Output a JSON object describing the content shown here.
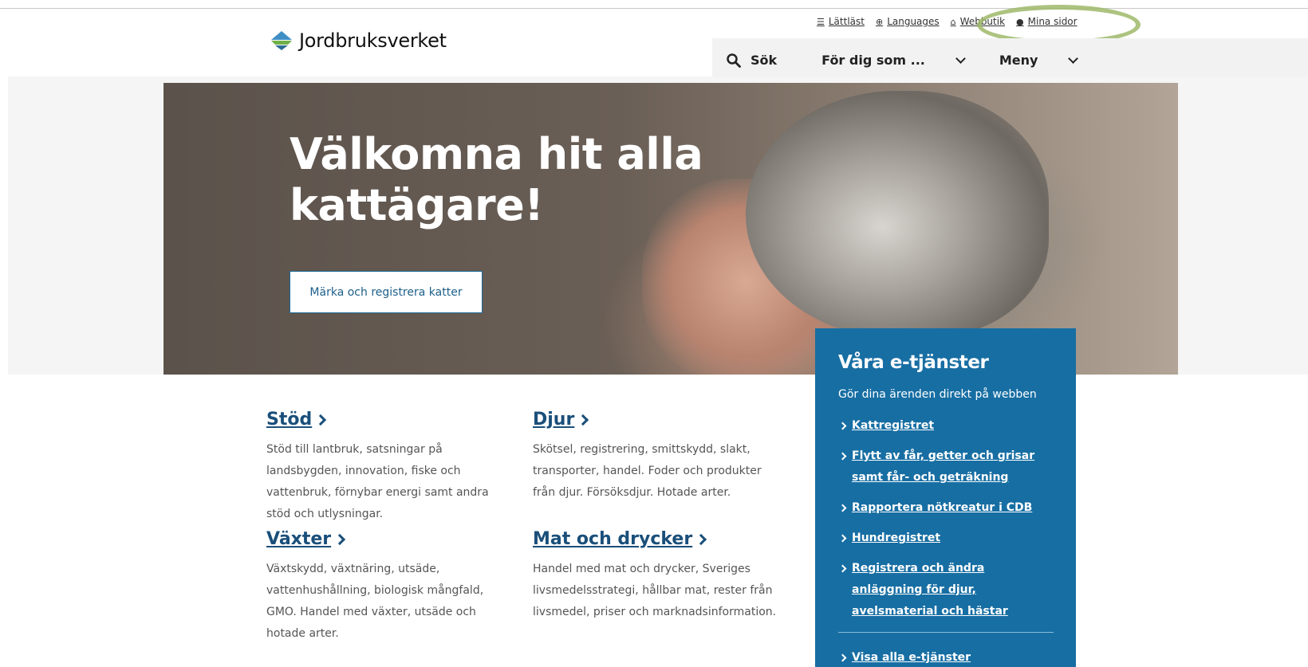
{
  "utility_bar": {
    "items": [
      {
        "label": "Lättläst",
        "icon": "easy-read-icon"
      },
      {
        "label": "Languages",
        "icon": "globe-icon"
      },
      {
        "label": "Webbutik",
        "icon": "basket-icon"
      },
      {
        "label": "Mina sidor",
        "icon": "user-icon"
      }
    ]
  },
  "logo": {
    "text": "Jordbruksverket"
  },
  "nav": {
    "search_label": "Sök",
    "for_you_label": "För dig som ...",
    "menu_label": "Meny"
  },
  "hero": {
    "title": "Välkomna hit alla kattägare!",
    "button_label": "Märka och registrera katter"
  },
  "categories": [
    {
      "title": "Stöd",
      "text": "Stöd till lantbruk, satsningar på landsbygden, innovation, fiske och vattenbruk, förnybar energi samt andra stöd och utlysningar."
    },
    {
      "title": "Djur",
      "text": "Skötsel, registrering, smittskydd, slakt, transporter, handel. Foder och produkter från djur. Försöksdjur. Hotade arter."
    },
    {
      "title": "Växter",
      "text": "Växtskydd, växtnäring, utsäde, vattenhushållning, biologisk mångfald, GMO. Handel med växter, utsäde och hotade arter."
    },
    {
      "title": "Mat och drycker",
      "text": "Handel med mat och drycker, Sveriges livsmedelsstrategi, hållbar mat, rester från livsmedel, priser och marknadsinformation."
    }
  ],
  "eservices": {
    "title": "Våra e-tjänster",
    "subtitle": "Gör dina ärenden direkt på webben",
    "links": [
      "Kattregistret",
      "Flytt av får, getter och grisar samt får- och geträkning",
      "Rapportera nötkreatur i CDB",
      "Hundregistret",
      "Registrera och ändra anläggning för djur, avelsmaterial och hästar"
    ],
    "all_link": "Visa alla e-tjänster"
  },
  "colors": {
    "brand_blue": "#176ea3",
    "link_blue": "#1a4f7a",
    "nav_bg": "#f2f2f2",
    "highlight": "#9fb86a"
  }
}
